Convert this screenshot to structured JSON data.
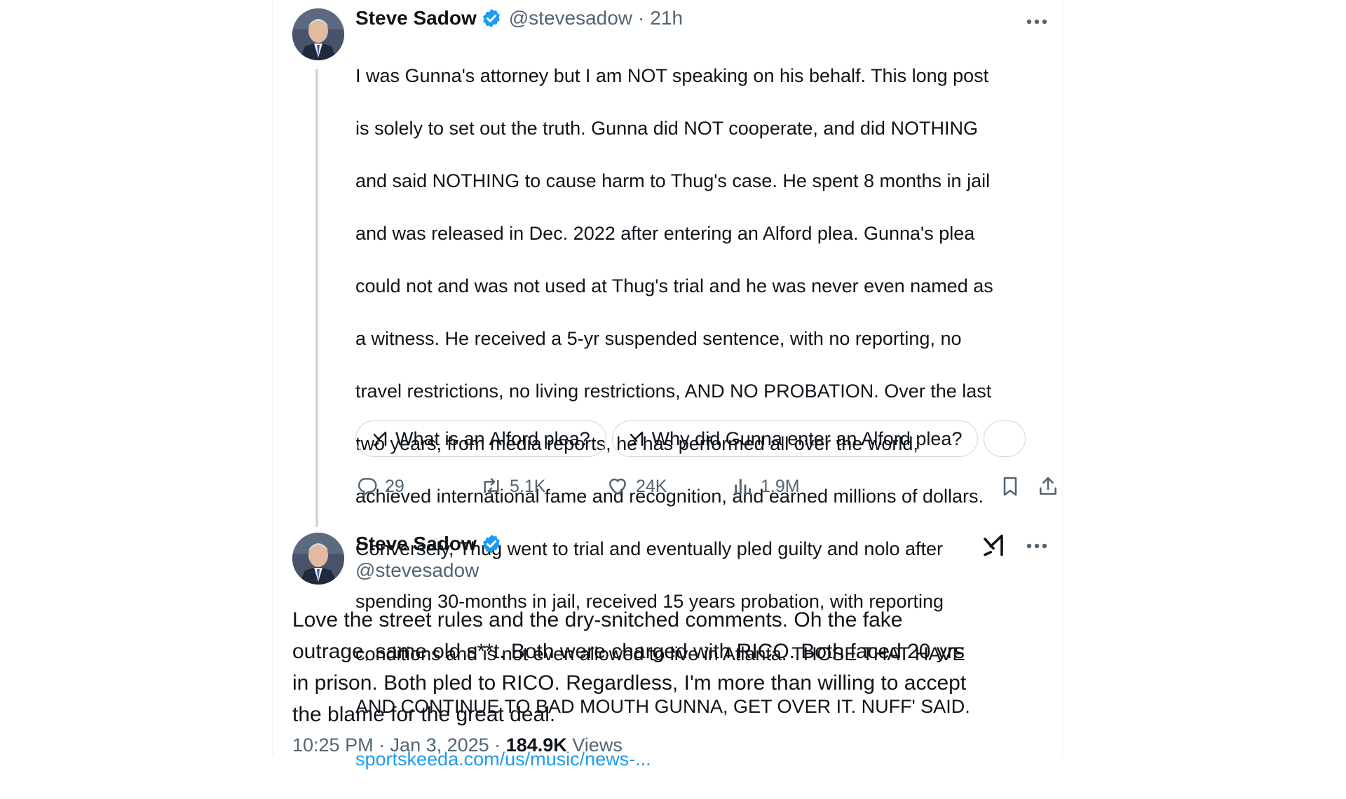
{
  "tweet1": {
    "display_name": "Steve Sadow",
    "handle": "@stevesadow",
    "separator": "·",
    "time": "21h",
    "text_lines": [
      "I was Gunna's attorney but I am NOT speaking on his behalf. This long post",
      "is solely to set out the truth. Gunna did NOT cooperate, and did NOTHING",
      "and said NOTHING to cause harm to Thug's case. He spent 8 months in jail",
      "and was released in Dec. 2022 after entering an Alford plea. Gunna's plea",
      "could not and was not used at Thug's trial and he was never even named as",
      "a witness. He received a 5-yr suspended sentence, with no reporting, no",
      "travel restrictions, no living restrictions, AND NO PROBATION. Over the last",
      "two years, from media reports, he has performed all over the world,",
      "achieved international fame and recognition, and earned millions of dollars.",
      "Conversely, Thug went to trial and eventually pled guilty and nolo after",
      "spending 30-months in jail, received 15 years probation, with reporting",
      "conditions and is not even allowed to live in Atlanta. THOSE THAT HAVE",
      "AND CONTINUE TO BAD MOUTH GUNNA, GET OVER IT. NUFF' SAID."
    ],
    "link": "sportskeeda.com/us/music/news-...",
    "grok_chips": [
      "What is an Alford plea?",
      "Why did Gunna enter an Alford plea?"
    ],
    "stats": {
      "replies": "29",
      "reposts": "5.1K",
      "likes": "24K",
      "views": "1.9M"
    }
  },
  "tweet2": {
    "display_name": "Steve Sadow",
    "handle": "@stevesadow",
    "text_lines": [
      "Love the street rules and the dry-snitched comments. Oh the fake",
      "outrage, same old s**t. Both were charged with RICO. Both faced 20 yrs",
      "in prison. Both pled to RICO. Regardless, I'm more than willing to accept",
      "the blame for the great deal."
    ],
    "timestamp": "10:25 PM · Jan 3, 2025 ·",
    "views_count": "184.9K",
    "views_label": "Views"
  },
  "colors": {
    "text": "#0f1419",
    "secondary": "#536471",
    "link": "#1d9bf0",
    "verified": "#1d9bf0",
    "border": "#cfd9de"
  },
  "icons": [
    "verified-badge-icon",
    "more-options-icon",
    "grok-icon",
    "reply-icon",
    "repost-icon",
    "like-icon",
    "views-icon",
    "bookmark-icon",
    "share-icon"
  ]
}
